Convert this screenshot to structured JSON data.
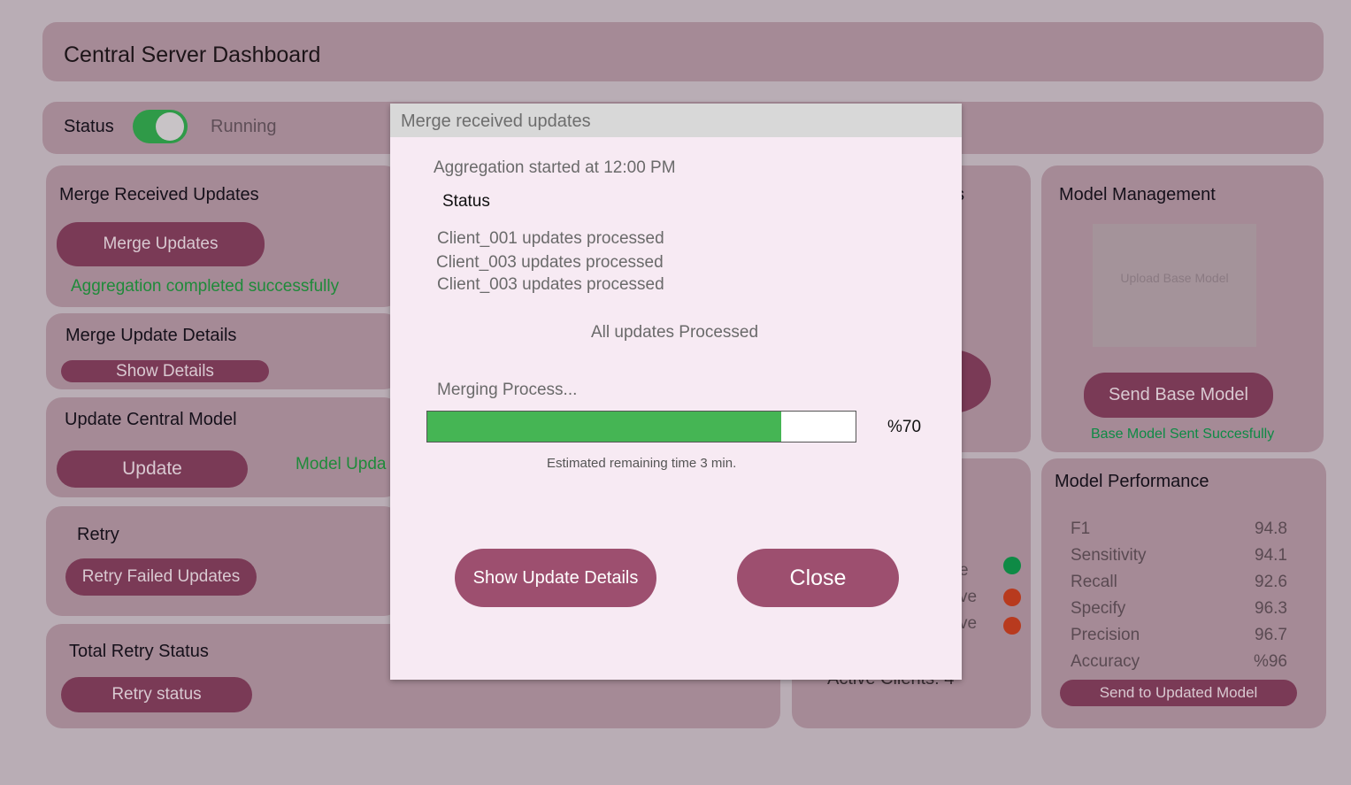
{
  "header": {
    "title": "Central Server Dashboard"
  },
  "status": {
    "label": "Status",
    "state": "Running",
    "toggle_on": true
  },
  "merge_received": {
    "title": "Merge Received Updates",
    "button": "Merge Updates",
    "message": "Aggregation completed successfully"
  },
  "merge_details": {
    "title": "Merge Update Details",
    "button": "Show Details"
  },
  "update_central": {
    "title": "Update Central Model",
    "button": "Update",
    "message": "Model Upda"
  },
  "retry": {
    "title": "Retry",
    "button": "Retry Failed Updates"
  },
  "total_retry": {
    "title": "Total Retry Status",
    "button": "Retry status"
  },
  "clients": {
    "title": "s",
    "items": [
      {
        "label": "e",
        "color": "#0e8a45"
      },
      {
        "label": "ve",
        "color": "#b83a1e"
      },
      {
        "label": "ve",
        "color": "#b83a1e"
      }
    ],
    "footer": "Active Clients: 4"
  },
  "model_management": {
    "title": "Model Management",
    "upload": "Upload Base Model",
    "button": "Send Base Model",
    "message": "Base Model Sent Succesfully"
  },
  "model_performance": {
    "title": "Model Performance",
    "metrics": [
      {
        "name": "F1",
        "value": "94.8"
      },
      {
        "name": "Sensitivity",
        "value": "94.1"
      },
      {
        "name": "Recall",
        "value": "92.6"
      },
      {
        "name": "Specify",
        "value": "96.3"
      },
      {
        "name": "Precision",
        "value": "96.7"
      },
      {
        "name": "Accuracy",
        "value": "%96"
      }
    ],
    "button": "Send to Updated Model"
  },
  "modal": {
    "title": "Merge received updates",
    "started": "Aggregation started at 12:00 PM",
    "status_label": "Status",
    "lines": [
      "Client_001 updates processed",
      "Client_003 updates processed",
      "Client_003 updates processed"
    ],
    "all_done": "All updates Processed",
    "process_label": "Merging Process...",
    "progress_percent": 70,
    "progress_text": "%70",
    "remaining": "Estimated remaining time 3 min.",
    "details_button": "Show Update Details",
    "close_button": "Close",
    "progress_color": "#45b554"
  }
}
